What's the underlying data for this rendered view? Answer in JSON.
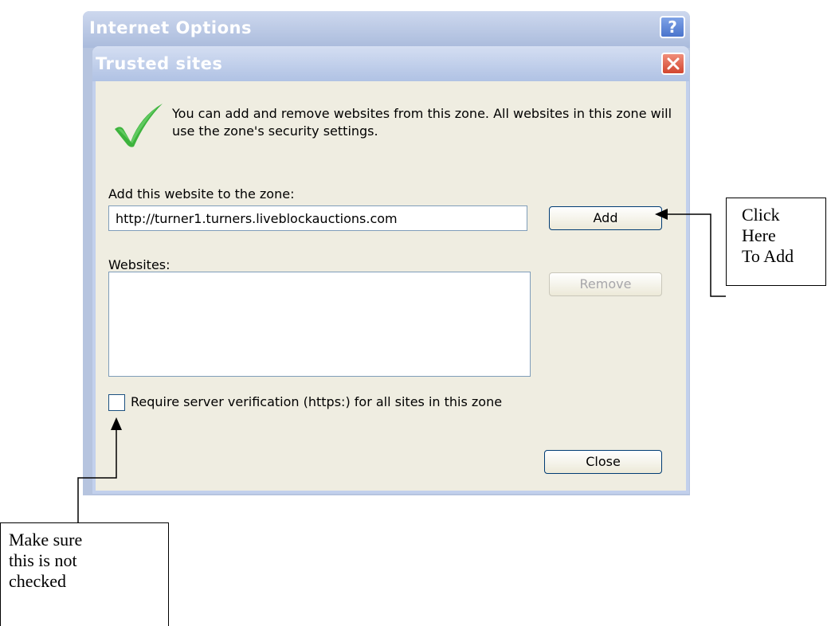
{
  "parent_window": {
    "title": "Internet Options",
    "help_glyph": "?"
  },
  "dialog": {
    "title": "Trusted sites",
    "description": "You can add and remove websites from this zone. All websites in this zone will use the zone's security settings.",
    "add_label": "Add this website to the zone:",
    "url_value": "http://turner1.turners.liveblockauctions.com",
    "add_button": "Add",
    "websites_label": "Websites:",
    "websites": [],
    "remove_button": "Remove",
    "require_verification_label": "Require server verification (https:) for all sites in this zone",
    "require_verification_checked": false,
    "close_button": "Close"
  },
  "annotations": {
    "add_callout_lines": [
      "Click",
      "Here",
      "To Add"
    ],
    "checkbox_callout_lines": [
      "Make sure",
      "this is not",
      "checked"
    ]
  },
  "icons": {
    "title_help": "help-icon",
    "title_close": "close-icon",
    "zone": "checkmark-icon"
  },
  "colors": {
    "titlebar": "#b0c2e4",
    "dialog_body": "#efede1",
    "close_red": "#d2462f",
    "check_green": "#3db33d"
  }
}
